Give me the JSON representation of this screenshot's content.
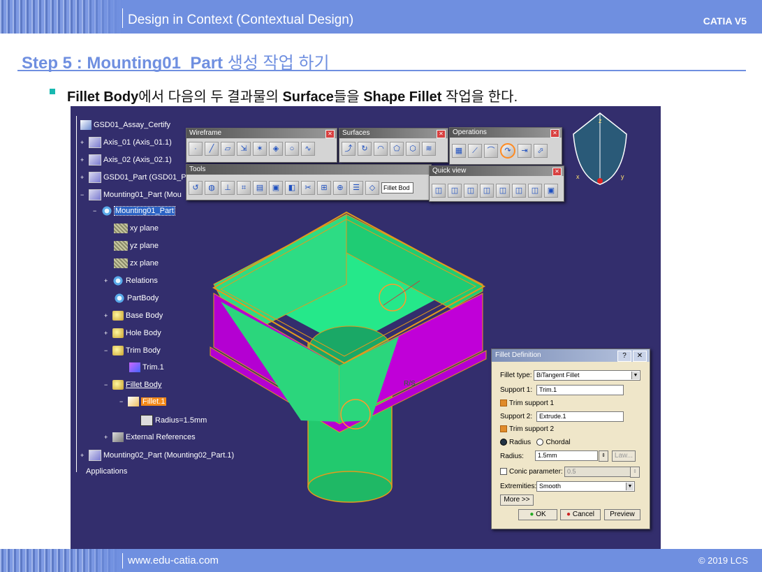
{
  "header": {
    "title": "Design in Context (Contextual Design)",
    "product": "CATIA V5"
  },
  "slide": {
    "step_label": "Step 5 : Mounting01_Part",
    "step_korean": "생성 작업 하기",
    "bullet": {
      "part1": "Fillet Body",
      "part2": "에서 다음의 두 결과물의 ",
      "part3": "Surface",
      "part4": "들을 ",
      "part5": "Shape Fillet",
      "part6": " 작업을 한다."
    }
  },
  "footer": {
    "website": "www.edu-catia.com",
    "copyright": "© 2019 LCS"
  },
  "tree": {
    "items": [
      "GSD01_Assay_Certify",
      "Axis_01 (Axis_01.1)",
      "Axis_02 (Axis_02.1)",
      "GSD01_Part (GSD01_P",
      "Mounting01_Part (Mou",
      "Mounting01_Part",
      "xy plane",
      "yz plane",
      "zx plane",
      "Relations",
      "PartBody",
      "Base Body",
      "Hole Body",
      "Trim Body",
      "Trim.1",
      "Fillet Body",
      "Fillet.1",
      "Radius=1.5mm",
      "External References",
      "Mounting02_Part (Mounting02_Part.1)",
      "Applications"
    ]
  },
  "toolbars": {
    "wireframe": "Wireframe",
    "surfaces": "Surfaces",
    "operations": "Operations",
    "tools": "Tools",
    "quick_view": "Quick view",
    "tools_field": "Fillet Bod"
  },
  "viewport_labels": {
    "compass_z": "z",
    "compass_x": "x",
    "compass_y": "y",
    "feature_label": "R/S"
  },
  "dialog": {
    "title": "Fillet Definition",
    "help": "?",
    "close": "✕",
    "fillet_type_label": "Fillet type:",
    "fillet_type_value": "BiTangent Fillet",
    "support1_label": "Support 1:",
    "support1_value": "Trim.1",
    "trim_support1": "Trim support 1",
    "support2_label": "Support 2:",
    "support2_value": "Extrude.1",
    "trim_support2": "Trim support 2",
    "radius_option": "Radius",
    "chordal_option": "Chordal",
    "radius_label": "Radius:",
    "radius_value": "1.5mm",
    "law_button": "Law...",
    "conic_label": "Conic parameter:",
    "conic_value": "0.5",
    "extremities_label": "Extremities:",
    "extremities_value": "Smooth",
    "more_button": "More >>",
    "ok_button": "OK",
    "cancel_button": "Cancel",
    "preview_button": "Preview"
  },
  "colors": {
    "accent": "#6f8fe0",
    "viewport_bg": "#332e6d",
    "part_green": "#22e07a",
    "part_magenta": "#b400d2",
    "edge_orange": "#f0a020"
  }
}
